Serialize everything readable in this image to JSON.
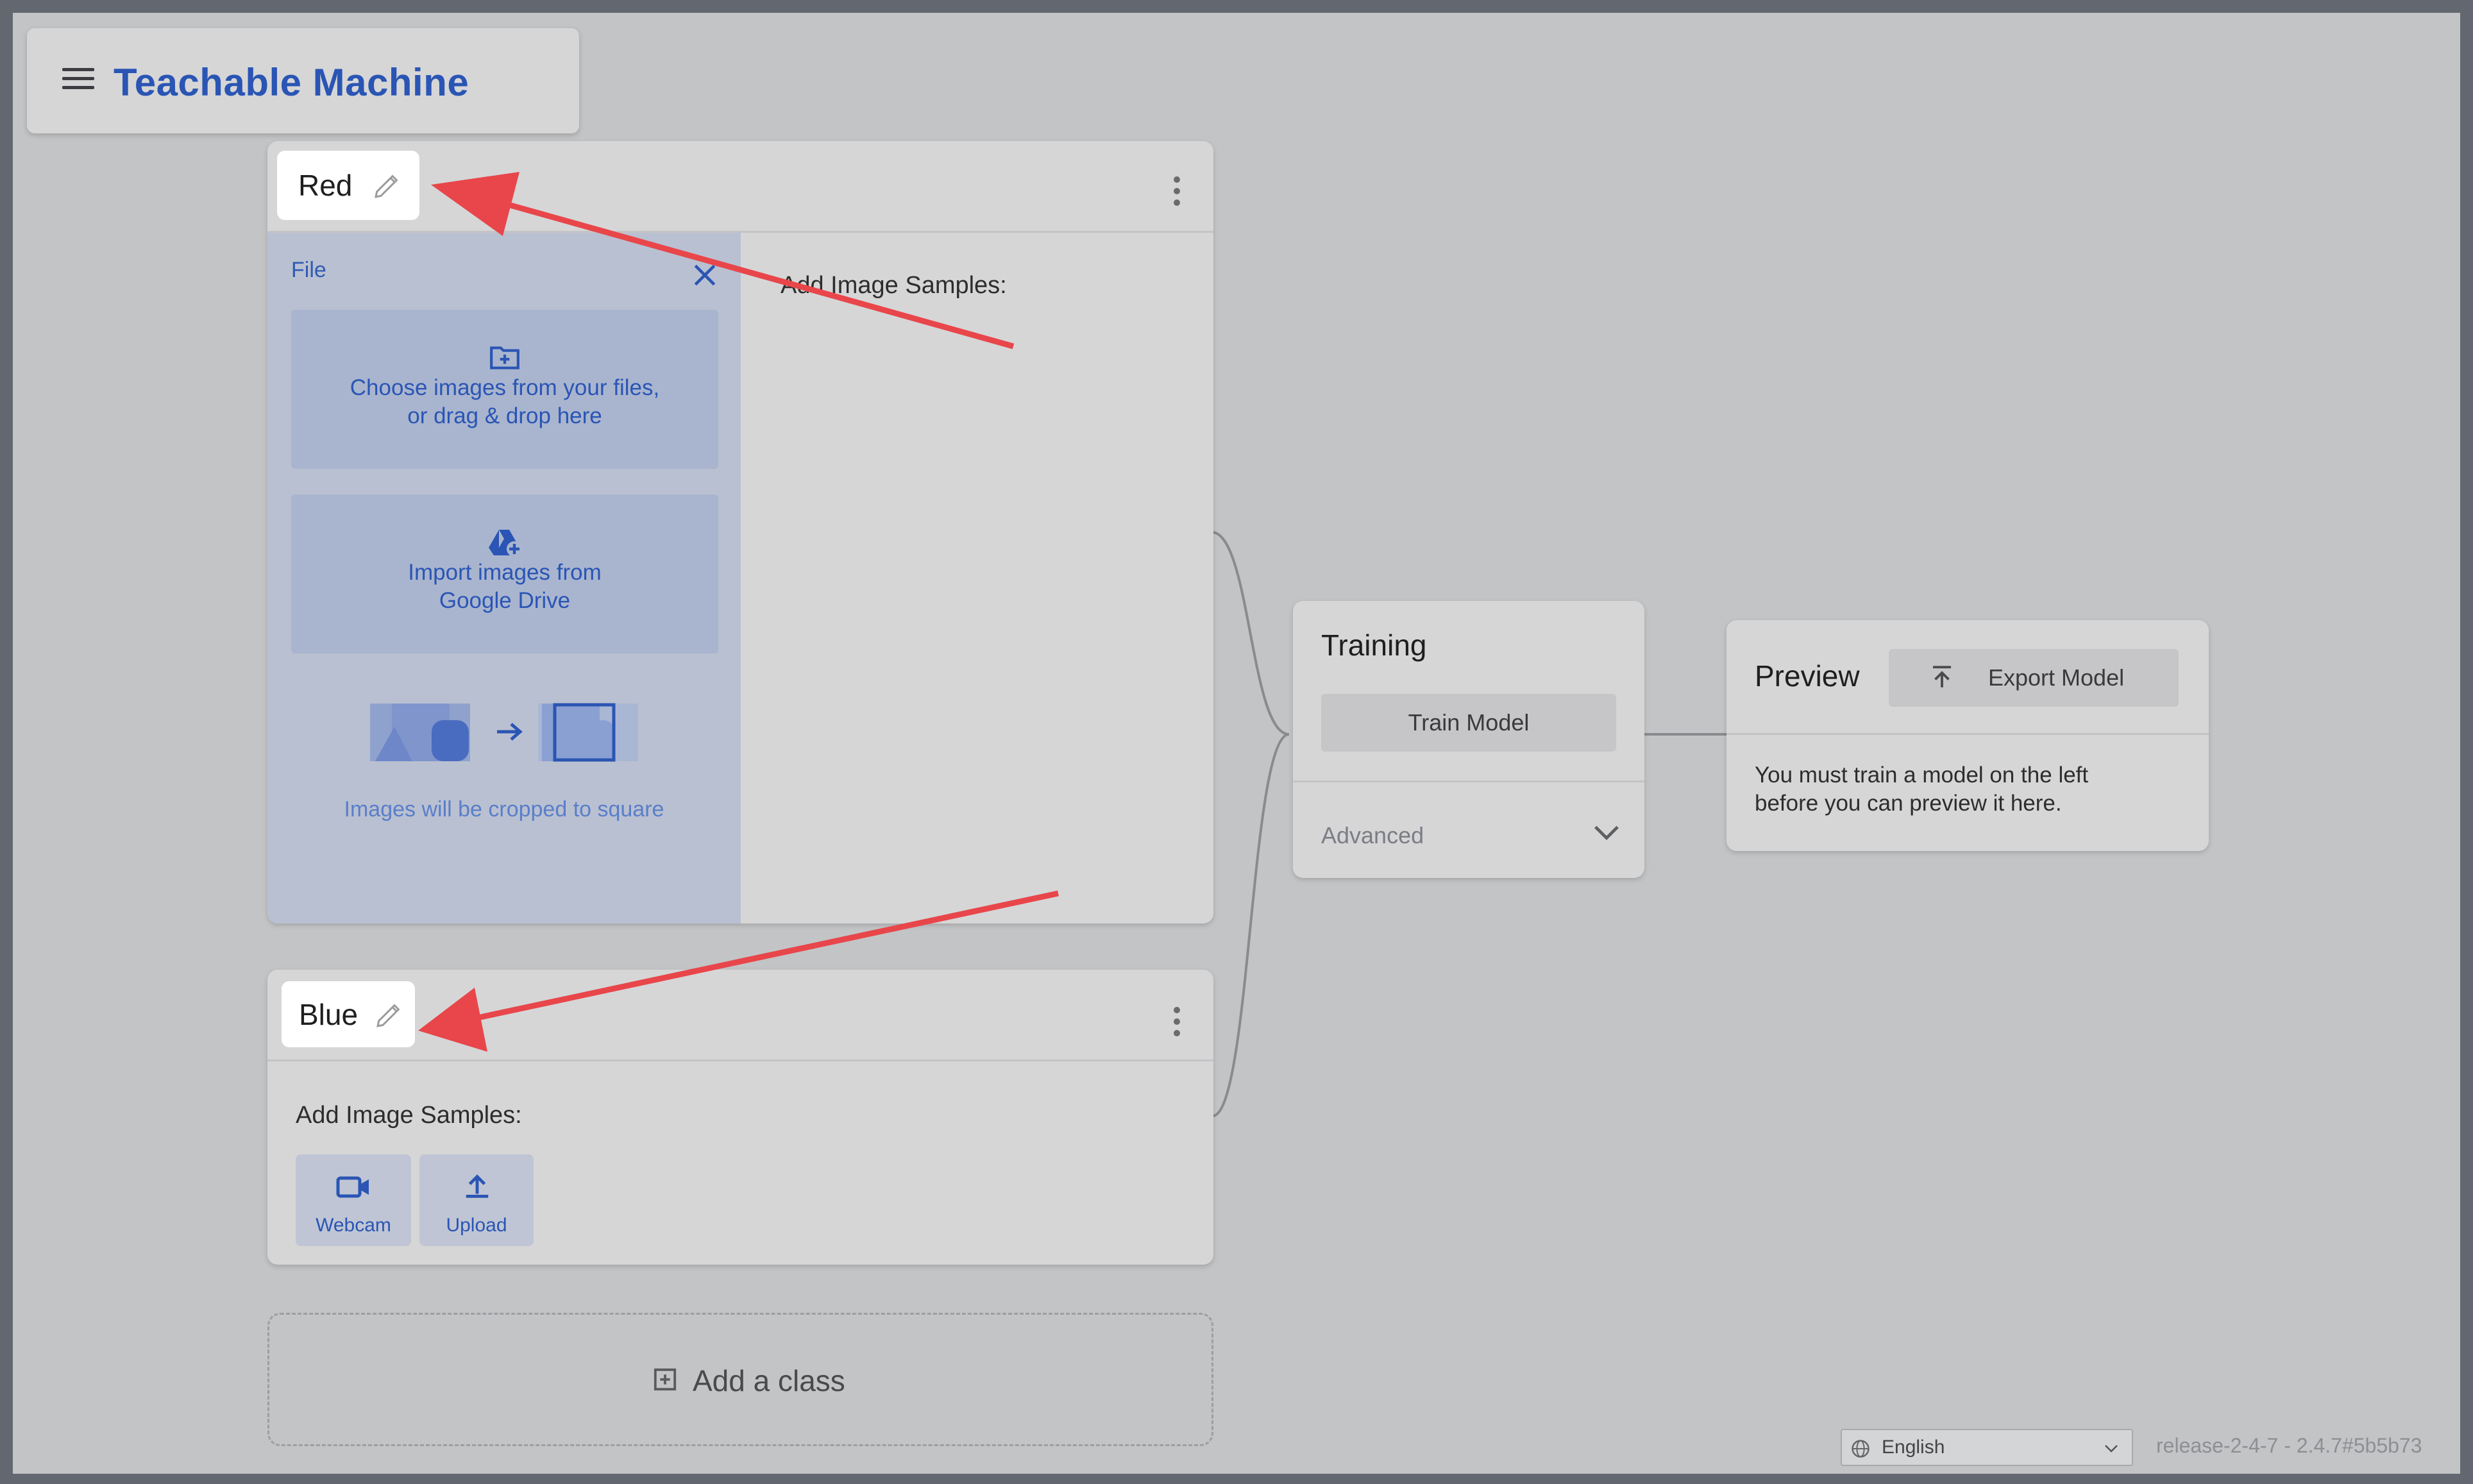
{
  "app": {
    "title": "Teachable Machine"
  },
  "classes": [
    {
      "name": "Red",
      "panel": {
        "tab_label": "File",
        "choose_files": "Choose images from your files,\nor drag & drop here",
        "google_drive": "Import images from\nGoogle Drive",
        "crop_note": "Images will be cropped to square"
      },
      "samples_label": "Add Image Samples:"
    },
    {
      "name": "Blue",
      "samples_label": "Add Image Samples:",
      "webcam_label": "Webcam",
      "upload_label": "Upload"
    }
  ],
  "add_class_label": "Add a class",
  "training": {
    "title": "Training",
    "train_button": "Train Model",
    "advanced_label": "Advanced"
  },
  "preview": {
    "title": "Preview",
    "export_button": "Export Model",
    "message": "You must train a model on the left\nbefore you can preview it here."
  },
  "footer": {
    "language": "English",
    "version": "release-2-4-7 - 2.4.7#5b5b73"
  },
  "annotation_color": "#e8464a",
  "accent_color": "#2a55b4"
}
